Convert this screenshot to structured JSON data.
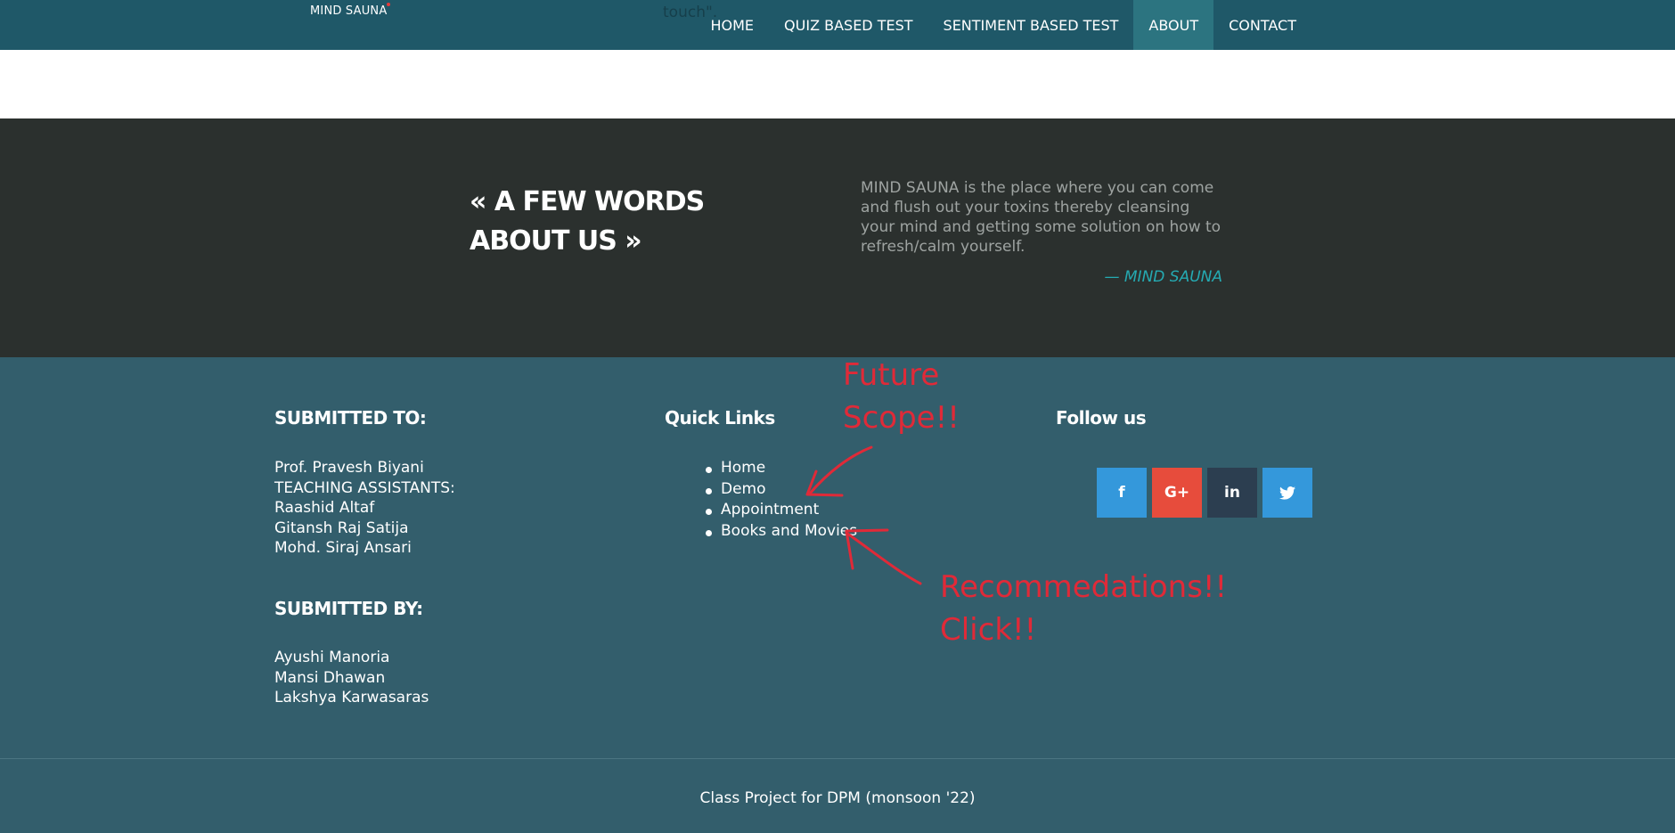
{
  "navbar": {
    "brand": "MIND SAUNA",
    "partial_text": "touch\".",
    "items": [
      {
        "label": "HOME"
      },
      {
        "label": "QUIZ BASED TEST"
      },
      {
        "label": "SENTIMENT BASED TEST"
      },
      {
        "label": "ABOUT",
        "active": true
      },
      {
        "label": "CONTACT"
      }
    ]
  },
  "about": {
    "heading_line1": "« A FEW WORDS",
    "heading_line2": "ABOUT US »",
    "quote": "MIND SAUNA is the place where you can come and flush out your toxins thereby cleansing your mind and getting some solution on how to refresh/calm yourself.",
    "author": "— MIND SAUNA"
  },
  "footer": {
    "submitted_to": {
      "heading": "SUBMITTED TO:",
      "lines": [
        "Prof. Pravesh Biyani",
        "TEACHING ASSISTANTS:",
        "Raashid Altaf",
        "Gitansh Raj Satija",
        "Mohd. Siraj Ansari"
      ]
    },
    "submitted_by": {
      "heading": "SUBMITTED BY:",
      "lines": [
        "Ayushi Manoria",
        "Mansi Dhawan",
        "Lakshya Karwasaras"
      ]
    },
    "quick_links": {
      "heading": "Quick Links",
      "items": [
        "Home",
        "Demo",
        "Appointment",
        "Books and Movies"
      ]
    },
    "follow": {
      "heading": "Follow us",
      "buttons": [
        {
          "icon": "facebook-icon",
          "glyph": "f",
          "color": "#3498db"
        },
        {
          "icon": "google-plus-icon",
          "glyph": "G+",
          "color": "#e74c3c"
        },
        {
          "icon": "linkedin-icon",
          "glyph": "in",
          "color": "#2c3e50"
        },
        {
          "icon": "twitter-icon",
          "glyph": "t",
          "color": "#3498db"
        }
      ]
    },
    "copyright": "Class Project for DPM (monsoon '22)"
  },
  "annotations": {
    "future_scope_line1": "Future",
    "future_scope_line2": "Scope!!",
    "recommendations_line1": "Recommedations!!",
    "recommendations_line2": "Click!!",
    "color": "#e02a38"
  },
  "colors": {
    "navbar": "#1f5868",
    "nav_active": "#2c7480",
    "about_bg": "#2b302e",
    "footer_bg": "#335e6c",
    "accent": "#25aab2"
  }
}
